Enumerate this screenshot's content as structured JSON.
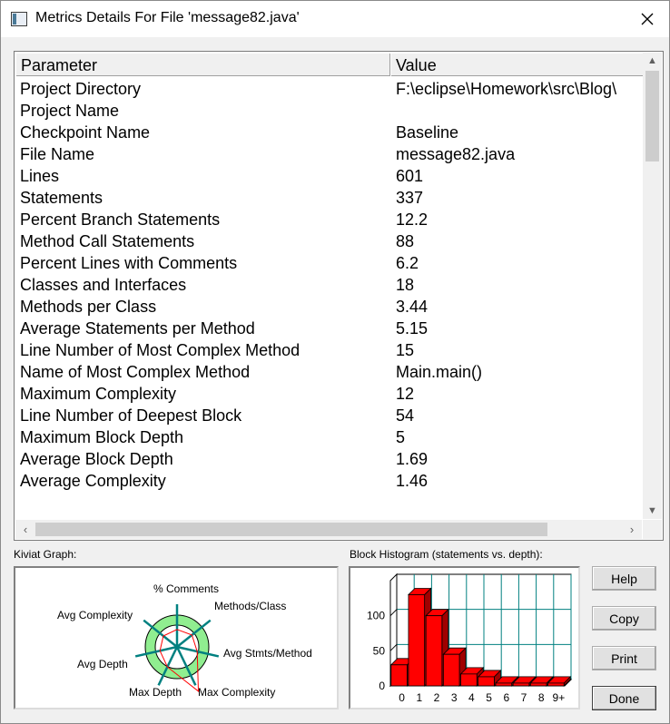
{
  "window": {
    "title": "Metrics Details For File 'message82.java'",
    "icon": "window-icon",
    "close_icon": "close-icon"
  },
  "table": {
    "headers": {
      "parameter": "Parameter",
      "value": "Value"
    },
    "rows": [
      {
        "parameter": "Project Directory",
        "value": "F:\\eclipse\\Homework\\src\\Blog\\"
      },
      {
        "parameter": "Project Name",
        "value": ""
      },
      {
        "parameter": "Checkpoint Name",
        "value": "Baseline"
      },
      {
        "parameter": "File Name",
        "value": "message82.java"
      },
      {
        "parameter": "Lines",
        "value": "601"
      },
      {
        "parameter": "Statements",
        "value": "337"
      },
      {
        "parameter": "Percent Branch Statements",
        "value": "12.2"
      },
      {
        "parameter": "Method Call Statements",
        "value": "88"
      },
      {
        "parameter": "Percent Lines with Comments",
        "value": "6.2"
      },
      {
        "parameter": "Classes and Interfaces",
        "value": "18"
      },
      {
        "parameter": "Methods per Class",
        "value": "3.44"
      },
      {
        "parameter": "Average Statements per Method",
        "value": "5.15"
      },
      {
        "parameter": "Line Number of Most Complex Method",
        "value": "15"
      },
      {
        "parameter": "Name of Most Complex Method",
        "value": "Main.main()"
      },
      {
        "parameter": "Maximum Complexity",
        "value": "12"
      },
      {
        "parameter": "Line Number of Deepest Block",
        "value": "54"
      },
      {
        "parameter": "Maximum Block Depth",
        "value": "5"
      },
      {
        "parameter": "Average Block Depth",
        "value": "1.69"
      },
      {
        "parameter": "Average Complexity",
        "value": "1.46"
      }
    ]
  },
  "kiviat": {
    "label": "Kiviat Graph:",
    "axes": [
      "% Comments",
      "Methods/Class",
      "Avg Stmts/Method",
      "Max Complexity",
      "Max Depth",
      "Avg Depth",
      "Avg Complexity"
    ],
    "colors": {
      "ring": "#90ee90",
      "axis": "#008080",
      "plot": "#ff0000"
    }
  },
  "histogram": {
    "label": "Block Histogram (statements vs. depth):",
    "colors": {
      "bar": "#ff0000",
      "bar_side": "#a00000",
      "grid": "#008080"
    }
  },
  "chart_data": {
    "type": "bar",
    "categories": [
      "0",
      "1",
      "2",
      "3",
      "4",
      "5",
      "6",
      "7",
      "8",
      "9+"
    ],
    "values": [
      30,
      130,
      100,
      45,
      17,
      13,
      4,
      4,
      4,
      4
    ],
    "ylim": [
      0,
      150
    ],
    "yticks": [
      "0",
      "50",
      "100"
    ],
    "grid": true,
    "three_d": true
  },
  "buttons": {
    "help": "Help",
    "copy": "Copy",
    "print": "Print",
    "done": "Done"
  }
}
